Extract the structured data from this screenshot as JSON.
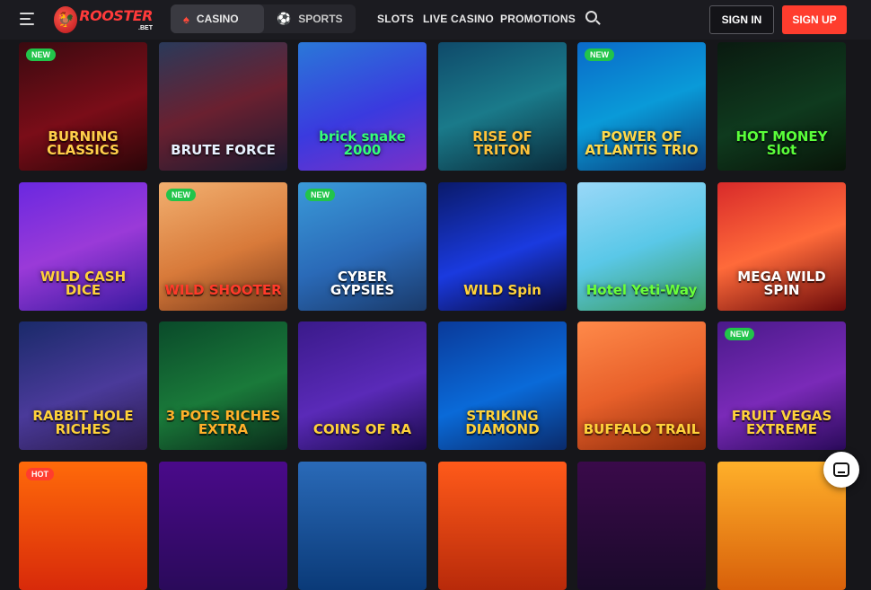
{
  "header": {
    "logo_main": "ROOSTER",
    "logo_sub": ".BET",
    "tabs": [
      {
        "label": "CASINO",
        "icon": "spade-icon"
      },
      {
        "label": "SPORTS",
        "icon": "soccer-ball-icon"
      }
    ],
    "nav": [
      "SLOTS",
      "LIVE CASINO",
      "PROMOTIONS"
    ],
    "sign_in": "SIGN IN",
    "sign_up": "SIGN UP"
  },
  "colors": {
    "accent": "#ff3d2e",
    "new_badge": "#22c44a",
    "background": "#16161a"
  },
  "games": [
    {
      "title": "BURNING CLASSICS",
      "badge": "NEW",
      "bg": "linear-gradient(160deg,#3a0a10,#7a0d18 55%,#2a0508)",
      "color": "#ffcf4a"
    },
    {
      "title": "BRUTE FORCE",
      "badge": "",
      "bg": "linear-gradient(160deg,#2a3a5a,#6a2030 50%,#1a1a30)",
      "color": "#e8f2ff"
    },
    {
      "title": "brick snake 2000",
      "badge": "",
      "bg": "linear-gradient(160deg,#2a78d8,#3a3adf 55%,#7a30c8)",
      "color": "#35ff7a"
    },
    {
      "title": "RISE OF TRITON",
      "badge": "",
      "bg": "linear-gradient(160deg,#0f4a6a,#1a7a8a 50%,#0a2a3a)",
      "color": "#ffc23a"
    },
    {
      "title": "POWER OF ATLANTIS TRIO",
      "badge": "NEW",
      "bg": "linear-gradient(160deg,#0a6ac8,#0a9ad8 50%,#0a3a78)",
      "color": "#ffd84a"
    },
    {
      "title": "HOT MONEY Slot",
      "badge": "",
      "bg": "linear-gradient(160deg,#0a1a10,#0f3a1e 55%,#081408)",
      "color": "#5aff3a"
    },
    {
      "title": "WILD CASH DICE",
      "badge": "",
      "bg": "linear-gradient(160deg,#6a28e0,#9a3ad8 50%,#3a1aa0)",
      "color": "#ffd23a"
    },
    {
      "title": "WILD SHOOTER",
      "badge": "NEW",
      "bg": "linear-gradient(160deg,#f2b070,#d87a3a 55%,#7a3a1a)",
      "color": "#ff3a2a"
    },
    {
      "title": "CYBER GYPSIES",
      "badge": "NEW",
      "bg": "linear-gradient(160deg,#3a9ad8,#2a6ab8 55%,#1a3a6a)",
      "color": "#ffffff"
    },
    {
      "title": "WILD Spin",
      "badge": "",
      "bg": "linear-gradient(160deg,#0a1a6a,#1a3adf 55%,#0a0a3a)",
      "color": "#ffd23a"
    },
    {
      "title": "Hotel Yeti-Way",
      "badge": "",
      "bg": "linear-gradient(160deg,#9ad8f8,#5ac8e8 50%,#3a9a5a)",
      "color": "#6aff3a"
    },
    {
      "title": "MEGA WILD SPIN",
      "badge": "",
      "bg": "linear-gradient(160deg,#d82a2a,#ff6a3a 50%,#6a0a0a)",
      "color": "#ffffff"
    },
    {
      "title": "RABBIT HOLE RICHES",
      "badge": "",
      "bg": "linear-gradient(160deg,#1a2a6a,#4a3a9a 55%,#2a1a4a)",
      "color": "#ffd23a"
    },
    {
      "title": "3 POTS RICHES EXTRA",
      "badge": "",
      "bg": "linear-gradient(160deg,#0a4a2a,#1a7a3a 55%,#0a2a1a)",
      "color": "#ffb02a"
    },
    {
      "title": "COINS OF RA",
      "badge": "",
      "bg": "linear-gradient(160deg,#3a1a8a,#5a2ab8 55%,#1a0a4a)",
      "color": "#ffd23a"
    },
    {
      "title": "STRIKING DIAMOND",
      "badge": "",
      "bg": "linear-gradient(160deg,#0a3a9a,#0a6ad8 55%,#0a2a6a)",
      "color": "#ffd23a"
    },
    {
      "title": "BUFFALO TRAIL",
      "badge": "",
      "bg": "linear-gradient(160deg,#ff8a4a,#e8602a 50%,#8a2a0a)",
      "color": "#ffd23a"
    },
    {
      "title": "FRUIT VEGAS EXTREME",
      "badge": "NEW",
      "bg": "linear-gradient(160deg,#4a1a8a,#7a2ab8 55%,#2a0a5a)",
      "color": "#ffd23a"
    },
    {
      "title": "",
      "badge": "HOT",
      "bg": "linear-gradient(180deg,#ff6a0a,#d82a0a)",
      "color": "#ffffff"
    },
    {
      "title": "",
      "badge": "",
      "bg": "linear-gradient(180deg,#4a0a8a,#2a0a5a)",
      "color": "#ffffff"
    },
    {
      "title": "",
      "badge": "",
      "bg": "linear-gradient(180deg,#2a6ab8,#0a3a78)",
      "color": "#ffffff"
    },
    {
      "title": "",
      "badge": "",
      "bg": "linear-gradient(180deg,#ff5a1a,#b82a0a)",
      "color": "#ffffff"
    },
    {
      "title": "",
      "badge": "",
      "bg": "linear-gradient(180deg,#3a0a4a,#1a0a2a)",
      "color": "#ffffff"
    },
    {
      "title": "",
      "badge": "",
      "bg": "linear-gradient(180deg,#ffb02a,#d8600a)",
      "color": "#ffffff"
    }
  ]
}
